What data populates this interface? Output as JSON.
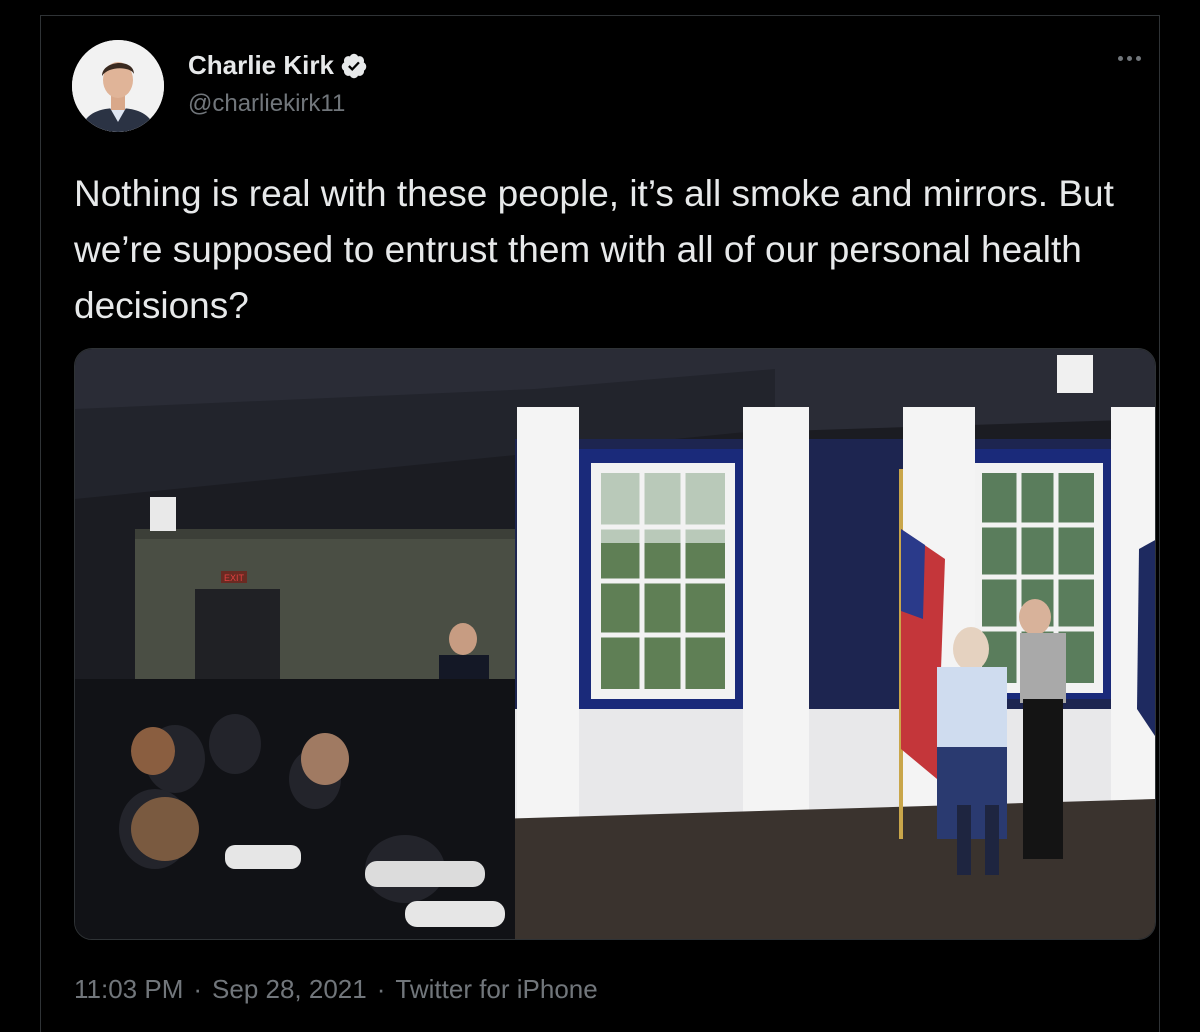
{
  "tweet": {
    "author": {
      "display_name": "Charlie Kirk",
      "handle": "@charliekirk11",
      "verified": true
    },
    "text": "Nothing is real with these people, it’s all smoke and mirrors. But we’re supposed to entrust them with all of our personal health decisions?",
    "media": {
      "sign_text": "EXIT"
    },
    "meta": {
      "time": "11:03 PM",
      "date": "Sep 28, 2021",
      "source": "Twitter for iPhone",
      "separator": "·"
    }
  },
  "icons": {
    "verified": "verified-badge-icon",
    "more": "more-options-icon"
  },
  "colors": {
    "background": "#000000",
    "text": "#e7e9ea",
    "secondary": "#71767b",
    "border": "#2f3336",
    "verified_badge": "#e7e9ea"
  }
}
